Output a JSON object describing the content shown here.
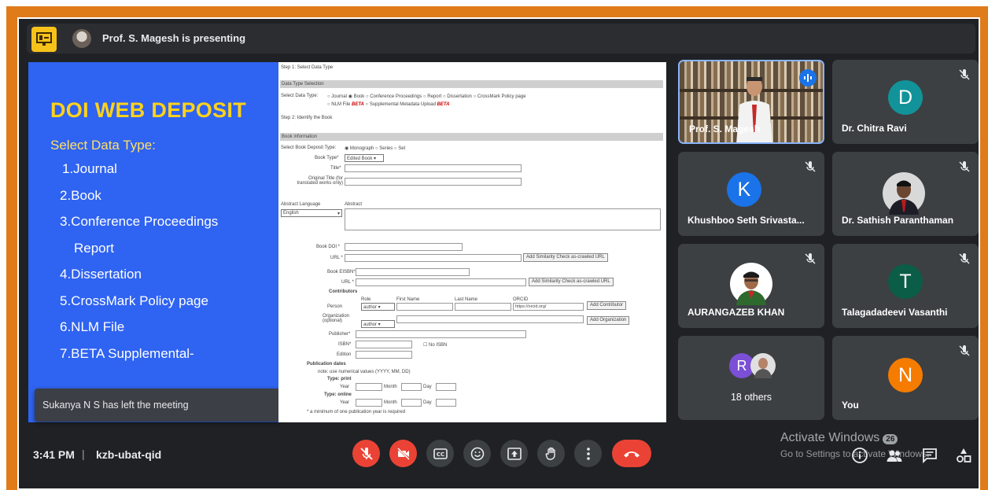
{
  "topbar": {
    "presenter_text": "Prof. S. Magesh is presenting"
  },
  "slide": {
    "title": "DOI WEB DEPOSIT",
    "subtitle": "Select Data Type:",
    "items": [
      "1.Journal",
      "2.Book",
      "3.Conference Proceedings",
      "Report",
      "4.Dissertation",
      "5.CrossMark Policy page",
      "6.NLM File",
      "7.BETA Supplemental-"
    ]
  },
  "toast": {
    "text": "Sukanya N S has left the meeting"
  },
  "doc": {
    "step1": "Step 1: Select Data Type",
    "section_data_type": "Data Type Selection",
    "select_label": "Select Data Type:",
    "type_options": [
      "Journal",
      "Book",
      "Conference Proceedings",
      "Report",
      "Dissertation",
      "CrossMark Policy page"
    ],
    "nlm_file": "NLM File",
    "beta": "BETA",
    "supplemental": "Supplemental Metadata Upload",
    "step2": "Step 2: Identify the Book",
    "section_book_info": "Book information",
    "deposit_type_label": "Select Book Deposit Type:",
    "deposit_options": [
      "Monograph",
      "Series",
      "Set"
    ],
    "book_type_label": "Book Type*",
    "book_type_value": "Edited Book",
    "title_label": "Title*",
    "original_title_label": "Original Title (for translated works only)",
    "abstract_language_label": "Abstract Language",
    "abstract_label": "Abstract",
    "abstract_language_value": "English",
    "book_doi_label": "Book DOI *",
    "url_label": "URL *",
    "similarity_button": "Add Similarity Check as-crawled URL",
    "book_eisbn_label": "Book EISBN*",
    "contributors_label": "Contributors",
    "person_label": "Person",
    "role_label": "Role",
    "role_value": "author",
    "first_name_label": "First Name",
    "last_name_label": "Last Name",
    "orcid_label": "ORCID",
    "orcid_placeholder": "https://orcid.org/",
    "add_contributor_button": "Add Contributor",
    "organization_label": "Organization (optional)",
    "add_organization_button": "Add Organization",
    "publisher_label": "Publisher*",
    "isbn_label": "ISBN*",
    "no_isbn_label": "No ISBN",
    "edition_label": "Edition",
    "publication_dates_label": "Publication dates",
    "note_text": "note: use numerical values (YYYY, MM, DD)",
    "print_label": "Type: print",
    "online_label": "Type: online",
    "year_label": "Year",
    "month_label": "Month",
    "day_label": "Day",
    "minimum_note": "* a minimum of one publication year is required"
  },
  "participants": [
    {
      "name": "Prof. S. Magesh",
      "type": "video"
    },
    {
      "name": "Dr. Chitra Ravi",
      "letter": "D",
      "color": "#12939a"
    },
    {
      "name": "Khushboo Seth Srivasta...",
      "letter": "K",
      "color": "#1a73e8"
    },
    {
      "name": "Dr. Sathish Paranthaman",
      "type": "photo"
    },
    {
      "name": "AURANGAZEB KHAN",
      "type": "photo"
    },
    {
      "name": "Talagadadeevi Vasanthi",
      "letter": "T",
      "color": "#0b5d47"
    },
    {
      "name": "18 others",
      "letter": "R",
      "color": "#7b4fd6"
    },
    {
      "name": "You",
      "letter": "N",
      "color": "#f57c00"
    }
  ],
  "bottombar": {
    "time": "3:41 PM",
    "separator": "|",
    "meeting_code": "kzb-ubat-qid"
  },
  "watermark": {
    "title": "Activate Windows",
    "subtitle": "Go to Settings to activate Windows.",
    "count": "26"
  },
  "colors": {
    "frame": "#e07b1a",
    "slide_bg": "#2f63f1",
    "slide_title": "#ffd21a",
    "hangup": "#ea4335"
  }
}
